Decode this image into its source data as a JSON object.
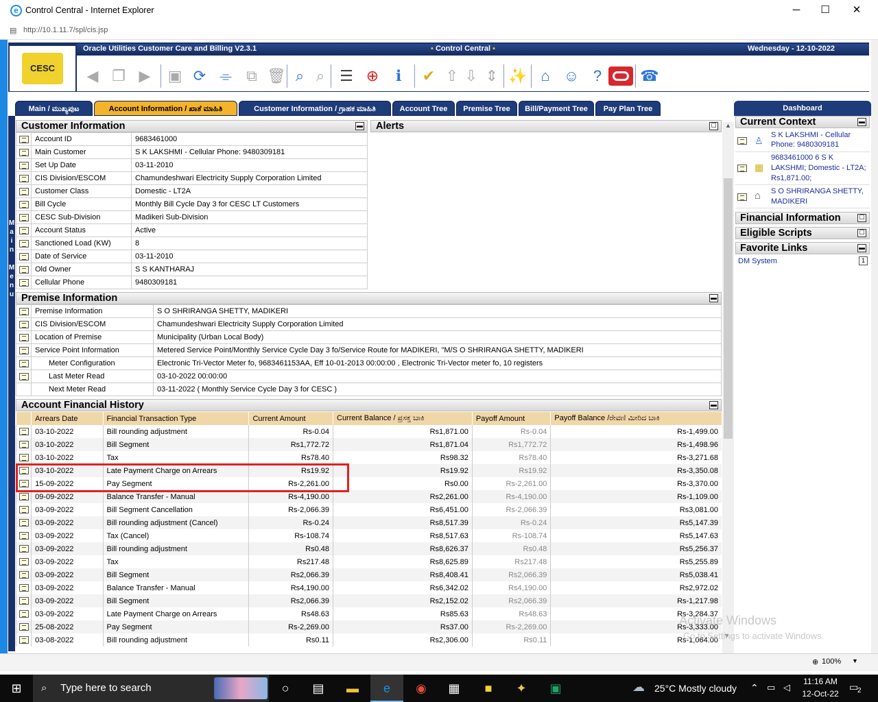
{
  "window": {
    "title": "Control Central - Internet Explorer",
    "url": "http://10.1.11.7/spl/cis.jsp"
  },
  "header": {
    "product": "Oracle Utilities Customer Care and Billing V2.3.1",
    "portal": "Control Central",
    "date": "Wednesday - 12-10-2022"
  },
  "tabs": [
    {
      "label": "Main / ಮುಖ್ಯಪುಟ"
    },
    {
      "label": "Account Information / ಖಾತೆ ಮಾಹಿತಿ"
    },
    {
      "label": "Customer Information / ಗ್ರಾಹಕ ಮಾಹಿತಿ"
    },
    {
      "label": "Account Tree"
    },
    {
      "label": "Premise Tree"
    },
    {
      "label": "Bill/Payment Tree"
    },
    {
      "label": "Pay Plan Tree"
    }
  ],
  "main_menu": [
    "M",
    "a",
    "i",
    "n",
    "",
    "M",
    "e",
    "n",
    "u"
  ],
  "customer_info": {
    "title": "Customer Information",
    "rows": [
      {
        "label": "Account ID",
        "value": "9683461000"
      },
      {
        "label": "Main Customer",
        "value": "S K LAKSHMI - Cellular Phone: 9480309181"
      },
      {
        "label": "Set Up Date",
        "value": "03-11-2010"
      },
      {
        "label": "CIS Division/ESCOM",
        "value": "Chamundeshwari Electricity Supply Corporation Limited"
      },
      {
        "label": "Customer Class",
        "value": "Domestic - LT2A"
      },
      {
        "label": "Bill Cycle",
        "value": "Monthly Bill Cycle Day 3 for CESC LT Customers"
      },
      {
        "label": "CESC Sub-Division",
        "value": "Madikeri Sub-Division"
      },
      {
        "label": "Account Status",
        "value": "Active"
      },
      {
        "label": "Sanctioned Load (KW)",
        "value": "8"
      },
      {
        "label": "Date of Service",
        "value": "03-11-2010"
      },
      {
        "label": "Old Owner",
        "value": "S S KANTHARAJ"
      },
      {
        "label": "Cellular Phone",
        "value": "9480309181"
      }
    ]
  },
  "alerts": {
    "title": "Alerts"
  },
  "premise_info": {
    "title": "Premise Information",
    "rows": [
      {
        "label": "Premise Information",
        "value": "S O SHRIRANGA SHETTY, MADIKERI",
        "icon": true
      },
      {
        "label": "CIS Division/ESCOM",
        "value": "Chamundeshwari Electricity Supply Corporation Limited",
        "icon": true
      },
      {
        "label": "Location of Premise",
        "value": "Municipality (Urban Local Body)",
        "icon": true
      },
      {
        "label": "Service Point Information",
        "value": "Metered Service Point/Monthly Service Cycle Day 3 fo/Service Route for MADIKERI, \"M/S O SHRIRANGA SHETTY, MADIKERI",
        "icon": true
      },
      {
        "label": "Meter Configuration",
        "value": "Electronic Tri-Vector Meter fo, 9683461153AA, Eff 10-01-2013 00:00:00 , Electronic Tri-Vector meter fo, 10 registers",
        "icon": true
      },
      {
        "label": "Last Meter Read",
        "value": "03-10-2022 00:00:00",
        "icon": true
      },
      {
        "label": "Next Meter Read",
        "value": "03-11-2022 ( Monthly Service Cycle Day 3 for CESC )",
        "icon": false
      }
    ]
  },
  "financial_history": {
    "title": "Account Financial History",
    "columns": [
      "Arrears Date",
      "Financial Transaction Type",
      "Current Amount",
      "Current Balance / ಪ್ರಸಕ್ತ ಬಾಕಿ",
      "Payoff Amount",
      "Payoff Balance /ರೇವಣಿ ಮೀರಿದ ಬಾಕಿ"
    ],
    "rows": [
      [
        "03-10-2022",
        "Bill rounding adjustment",
        "Rs-0.04",
        "Rs1,871.00",
        "Rs-0.04",
        "Rs-1,499.00"
      ],
      [
        "03-10-2022",
        "Bill Segment",
        "Rs1,772.72",
        "Rs1,871.04",
        "Rs1,772.72",
        "Rs-1,498.96"
      ],
      [
        "03-10-2022",
        "Tax",
        "Rs78.40",
        "Rs98.32",
        "Rs78.40",
        "Rs-3,271.68"
      ],
      [
        "03-10-2022",
        "Late Payment Charge on Arrears",
        "Rs19.92",
        "Rs19.92",
        "Rs19.92",
        "Rs-3,350.08"
      ],
      [
        "15-09-2022",
        "Pay Segment",
        "Rs-2,261.00",
        "Rs0.00",
        "Rs-2,261.00",
        "Rs-3,370.00"
      ],
      [
        "09-09-2022",
        "Balance Transfer - Manual",
        "Rs-4,190.00",
        "Rs2,261.00",
        "Rs-4,190.00",
        "Rs-1,109.00"
      ],
      [
        "03-09-2022",
        "Bill Segment Cancellation",
        "Rs-2,066.39",
        "Rs6,451.00",
        "Rs-2,066.39",
        "Rs3,081.00"
      ],
      [
        "03-09-2022",
        "Bill rounding adjustment (Cancel)",
        "Rs-0.24",
        "Rs8,517.39",
        "Rs-0.24",
        "Rs5,147.39"
      ],
      [
        "03-09-2022",
        "Tax (Cancel)",
        "Rs-108.74",
        "Rs8,517.63",
        "Rs-108.74",
        "Rs5,147.63"
      ],
      [
        "03-09-2022",
        "Bill rounding adjustment",
        "Rs0.48",
        "Rs8,626.37",
        "Rs0.48",
        "Rs5,256.37"
      ],
      [
        "03-09-2022",
        "Tax",
        "Rs217.48",
        "Rs8,625.89",
        "Rs217.48",
        "Rs5,255.89"
      ],
      [
        "03-09-2022",
        "Bill Segment",
        "Rs2,066.39",
        "Rs8,408.41",
        "Rs2,066.39",
        "Rs5,038.41"
      ],
      [
        "03-09-2022",
        "Balance Transfer - Manual",
        "Rs4,190.00",
        "Rs6,342.02",
        "Rs4,190.00",
        "Rs2,972.02"
      ],
      [
        "03-09-2022",
        "Bill Segment",
        "Rs2,066.39",
        "Rs2,152.02",
        "Rs2,066.39",
        "Rs-1,217.98"
      ],
      [
        "03-09-2022",
        "Late Payment Charge on Arrears",
        "Rs48.63",
        "Rs85.63",
        "Rs48.63",
        "Rs-3,284.37"
      ],
      [
        "25-08-2022",
        "Pay Segment",
        "Rs-2,269.00",
        "Rs37.00",
        "Rs-2,269.00",
        "Rs-3,333.00"
      ],
      [
        "03-08-2022",
        "Bill rounding adjustment",
        "Rs0.11",
        "Rs2,306.00",
        "Rs0.11",
        "Rs-1,064.00"
      ]
    ]
  },
  "dashboard": {
    "title": "Dashboard",
    "current_context": {
      "title": "Current Context",
      "items": [
        {
          "text": "S K LAKSHMI - Cellular Phone: 9480309181"
        },
        {
          "text": "9683461000 6 S K LAKSHMI; Domestic - LT2A; Rs1,871.00;"
        },
        {
          "text": "S O SHRIRANGA SHETTY, MADIKERI"
        }
      ]
    },
    "financial_information": "Financial Information",
    "eligible_scripts": "Eligible Scripts",
    "favorite_links": {
      "title": "Favorite Links",
      "link": "DM System",
      "badge": "1"
    }
  },
  "statusbar": {
    "zoom": "100%"
  },
  "watermark": {
    "line1": "Activate Windows",
    "line2": "Go to Settings to activate Windows."
  },
  "taskbar": {
    "search_placeholder": "Type here to search",
    "weather": "25°C  Mostly cloudy",
    "time": "11:16 AM",
    "date": "12-Oct-22",
    "notifications": "2"
  }
}
